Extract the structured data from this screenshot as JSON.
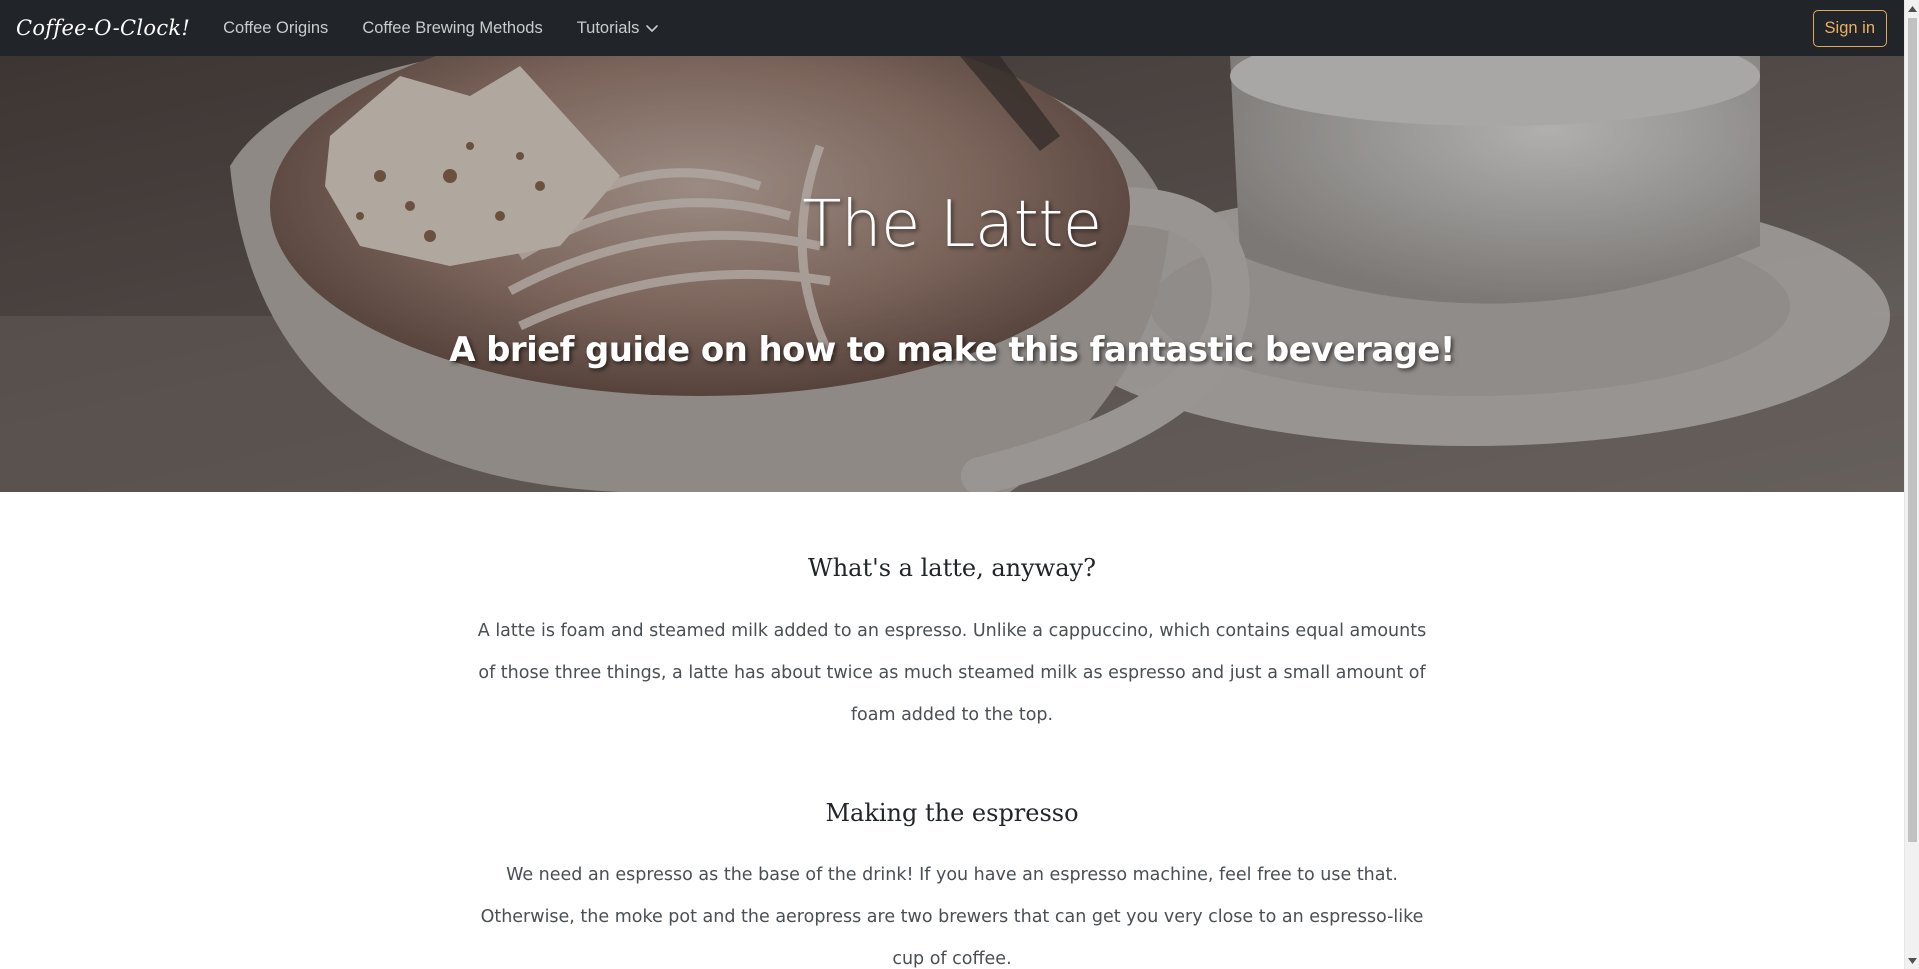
{
  "navbar": {
    "brand": "Coffee-O-Clock!",
    "links": [
      "Coffee Origins",
      "Coffee Brewing Methods",
      "Tutorials"
    ],
    "signin": "Sign in"
  },
  "hero": {
    "title": "The Latte",
    "subtitle": "A brief guide on how to make this fantastic beverage!"
  },
  "sections": [
    {
      "title": "What's a latte, anyway?",
      "text": "A latte is foam and steamed milk added to an espresso. Unlike a cappuccino, which contains equal amounts of those three things, a latte has about twice as much steamed milk as espresso and just a small amount of foam added to the top."
    },
    {
      "title": "Making the espresso",
      "text": "We need an espresso as the base of the drink! If you have an espresso machine, feel free to use that. Otherwise, the moke pot and the aeropress are two brewers that can get you very close to an espresso-like cup of coffee."
    }
  ],
  "colors": {
    "navbar_bg": "#212529",
    "accent": "#e8b160"
  },
  "icons": {
    "tutorials_dropdown": "chevron-down-icon",
    "scroll_up": "arrow-up-icon",
    "scroll_down": "arrow-down-icon"
  }
}
